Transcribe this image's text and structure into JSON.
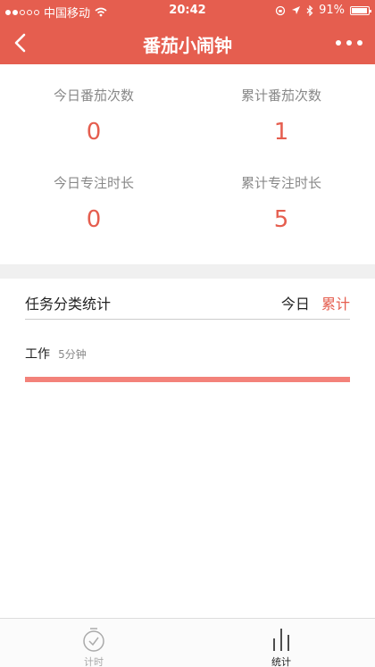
{
  "status_bar": {
    "carrier": "中国移动",
    "time": "20:42",
    "battery": "91%"
  },
  "nav": {
    "title": "番茄小闹钟"
  },
  "stats": {
    "today_count_label": "今日番茄次数",
    "today_count_value": "0",
    "total_count_label": "累计番茄次数",
    "total_count_value": "1",
    "today_focus_label": "今日专注时长",
    "today_focus_value": "0",
    "total_focus_label": "累计专注时长",
    "total_focus_value": "5"
  },
  "category_section": {
    "title": "任务分类统计",
    "toggle_today": "今日",
    "toggle_total": "累计",
    "items": [
      {
        "name": "工作",
        "duration": "5分钟",
        "share": 1.0
      }
    ]
  },
  "tabbar": {
    "timer_label": "计时",
    "stats_label": "统计"
  },
  "colors": {
    "accent": "#e55e4f",
    "bar": "#f3827a"
  }
}
